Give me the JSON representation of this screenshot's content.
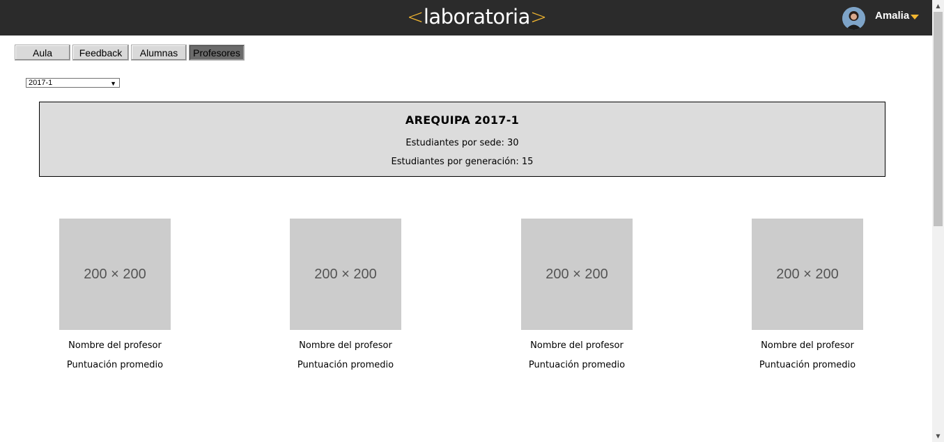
{
  "header": {
    "logo_left": "<",
    "logo_text": "laboratoria",
    "logo_right": ">",
    "user_name": "Amalia"
  },
  "tabs": [
    {
      "label": "Aula"
    },
    {
      "label": "Feedback"
    },
    {
      "label": "Alumnas"
    },
    {
      "label": "Profesores",
      "active": true
    }
  ],
  "filter": {
    "selected": "2017-1"
  },
  "summary": {
    "title": "AREQUIPA 2017-1",
    "students_by_site": "Estudiantes por sede: 30",
    "students_by_generation": "Estudiantes por generación: 15"
  },
  "teachers": [
    {
      "image_label": "200 × 200",
      "name": "Nombre del profesor",
      "score": "Puntuación promedio"
    },
    {
      "image_label": "200 × 200",
      "name": "Nombre del profesor",
      "score": "Puntuación promedio"
    },
    {
      "image_label": "200 × 200",
      "name": "Nombre del profesor",
      "score": "Puntuación promedio"
    },
    {
      "image_label": "200 × 200",
      "name": "Nombre del profesor",
      "score": "Puntuación promedio"
    }
  ],
  "colors": {
    "header_bg": "#2b2b2b",
    "accent": "#f2b630",
    "summary_bg": "#dcdcdc",
    "placeholder_bg": "#cccccc"
  }
}
